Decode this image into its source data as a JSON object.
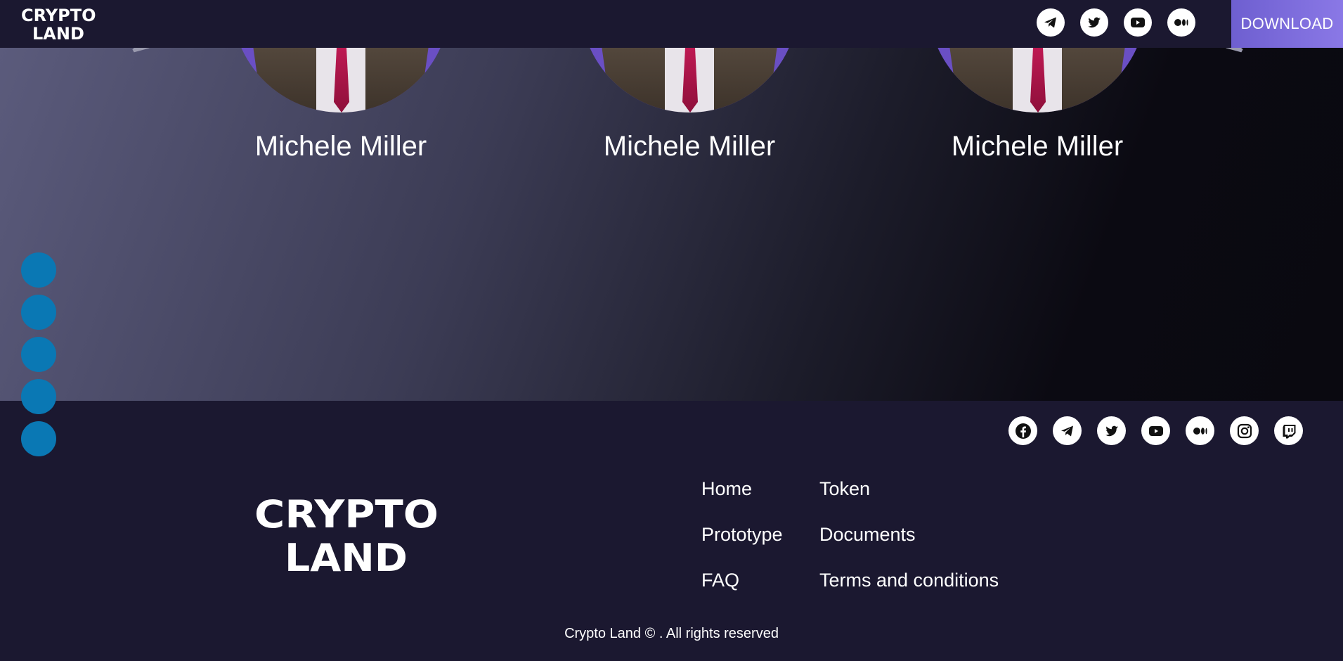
{
  "header": {
    "logo_text_line1": "CRYPTO",
    "logo_text_line2": "LAND",
    "social": [
      "telegram-icon",
      "twitter-icon",
      "youtube-icon",
      "medium-icon"
    ],
    "download_label": "DOWNLOAD"
  },
  "team": {
    "members": [
      {
        "name": "Michele Miller"
      },
      {
        "name": "Michele Miller"
      },
      {
        "name": "Michele Miller"
      }
    ]
  },
  "side_nav": {
    "dot_count": 5,
    "dot_color": "#0a78b4"
  },
  "footer": {
    "logo_text_line1": "CRYPTO",
    "logo_text_line2": "LAND",
    "social": [
      "facebook-icon",
      "telegram-icon",
      "twitter-icon",
      "youtube-icon",
      "medium-icon",
      "instagram-icon",
      "twitch-icon"
    ],
    "nav": [
      {
        "label": "Home"
      },
      {
        "label": "Token"
      },
      {
        "label": "Prototype"
      },
      {
        "label": "Documents"
      },
      {
        "label": "FAQ"
      },
      {
        "label": "Terms and conditions"
      }
    ],
    "copyright": "Crypto Land © . All rights reserved"
  },
  "colors": {
    "background": "#1b1830",
    "accent": "#7a6ad8",
    "dot": "#0a78b4"
  }
}
